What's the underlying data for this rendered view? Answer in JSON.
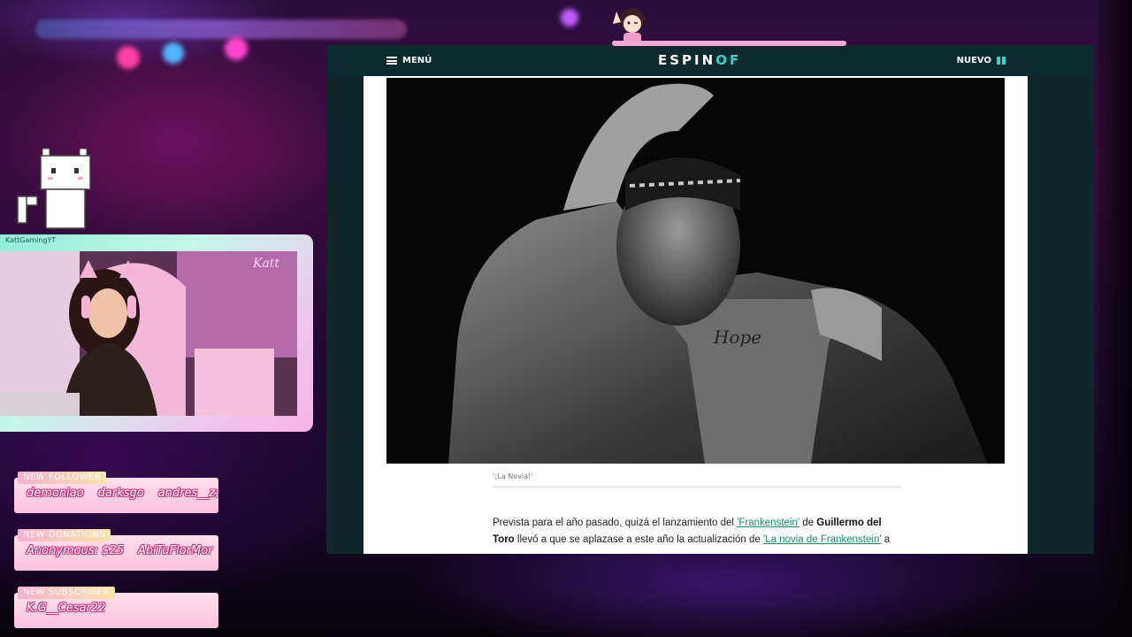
{
  "site": {
    "menu_label": "MENÚ",
    "logo_text": "ESPINOF",
    "new_label": "NUEVO",
    "accent_color": "#3ad1c7",
    "header_bg": "#0e2a31"
  },
  "article": {
    "caption": "'¡La Novia!'",
    "p1_part1": "Prevista para el año pasado, quizá el lanzamiento del ",
    "link1": "'Frankenstein'",
    "p1_part2": " de ",
    "bold1": "Guillermo del Toro",
    "p1_part3": " llevó a que se aplazase a este año la actualización de ",
    "link2": "'La novia de Frankenstein'",
    "p1_part4": " a",
    "link_color": "#1a8a73"
  },
  "stream": {
    "cam_label": "KattGamingYT",
    "neon_sign": "Katt",
    "alerts": [
      {
        "title": "NEW FOLLOWER",
        "names": [
          "demoniao",
          "darksgo",
          "andres__z;"
        ]
      },
      {
        "title": "NEW DONATIONS",
        "names": [
          "Anonymous: $25",
          "AbiTuFlorMor"
        ]
      },
      {
        "title": "NEW SUBSCRIBER",
        "names": [
          "K.G__Cesar22"
        ]
      }
    ]
  }
}
